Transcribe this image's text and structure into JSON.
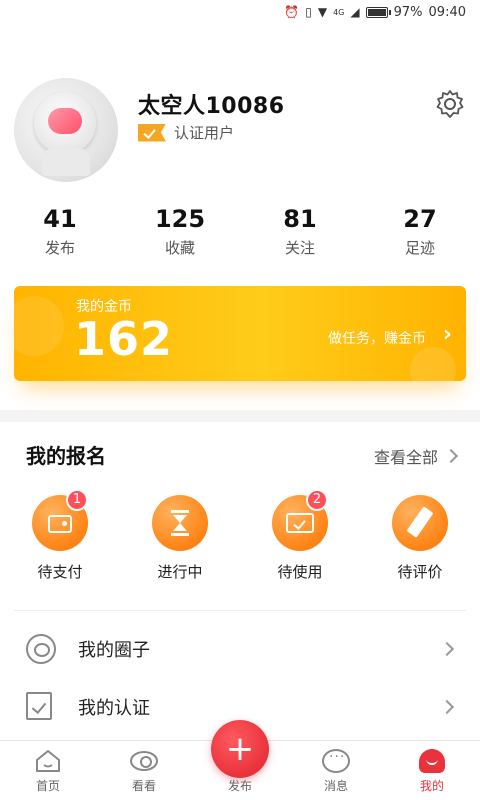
{
  "status_bar": {
    "battery": "97%",
    "time": "09:40",
    "icons": [
      "alarm-icon",
      "vibrate-icon",
      "wifi-icon",
      "4g-icon",
      "signal-icon",
      "battery-icon"
    ]
  },
  "profile": {
    "username": "太空人10086",
    "verified_label": "认证用户"
  },
  "stats": [
    {
      "value": "41",
      "label": "发布"
    },
    {
      "value": "125",
      "label": "收藏"
    },
    {
      "value": "81",
      "label": "关注"
    },
    {
      "value": "27",
      "label": "足迹"
    }
  ],
  "coin_card": {
    "title": "我的金币",
    "value": "162",
    "task_text": "做任务，赚金币",
    "arrow": "›"
  },
  "signup": {
    "title": "我的报名",
    "view_all": "查看全部",
    "items": [
      {
        "label": "待支付",
        "badge": "1",
        "icon": "wallet-icon"
      },
      {
        "label": "进行中",
        "badge": "",
        "icon": "hourglass-icon"
      },
      {
        "label": "待使用",
        "badge": "2",
        "icon": "ticket-icon"
      },
      {
        "label": "待评价",
        "badge": "",
        "icon": "pen-icon"
      }
    ]
  },
  "list": {
    "circle": "我的圈子",
    "certification": "我的认证"
  },
  "tabbar": {
    "home": "首页",
    "watch": "看看",
    "publish": "发布",
    "messages": "消息",
    "me": "我的",
    "publish_symbol": "+"
  },
  "colors": {
    "accent": "#e8323c",
    "coin_gradient_start": "#ffb400",
    "coin_gradient_mid": "#ffcc1a",
    "order_icon": "#ff8a1e",
    "badge": "#ff4f5a",
    "verified": "#f5a623"
  }
}
